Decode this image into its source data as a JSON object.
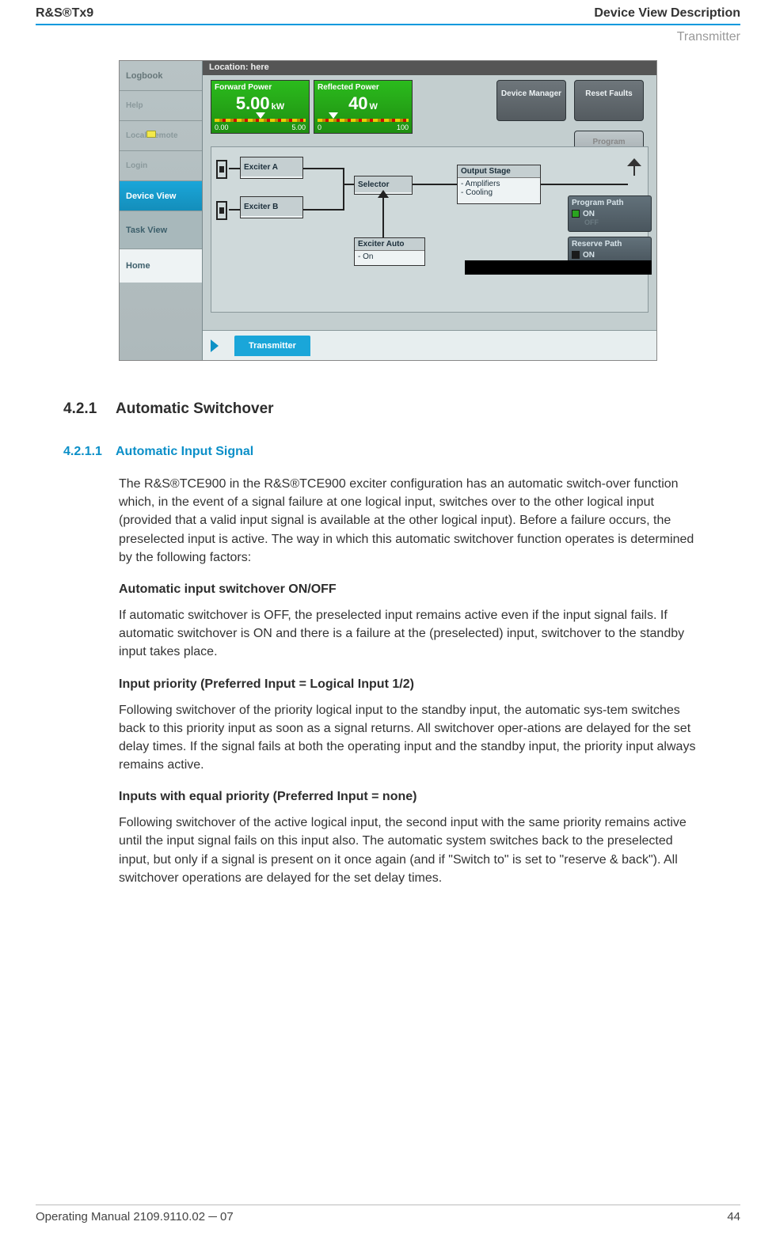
{
  "header": {
    "left": "R&S®Tx9",
    "right": "Device View Description"
  },
  "subheader": "Transmitter",
  "screenshot": {
    "sidebar": {
      "items": [
        {
          "label": "Logbook"
        },
        {
          "label": "Help"
        },
        {
          "label": "Local/Remote"
        },
        {
          "label": "Login"
        },
        {
          "label": "Device View"
        },
        {
          "label": "Task View"
        },
        {
          "label": "Home"
        }
      ]
    },
    "location": "Location: here",
    "forward_power": {
      "label": "Forward Power",
      "value": "5.00",
      "unit": "kW",
      "scale_min": "0.00",
      "scale_max": "5.00"
    },
    "reflected_power": {
      "label": "Reflected Power",
      "value": "40",
      "unit": "W",
      "scale_min": "0",
      "scale_max": "100"
    },
    "buttons": {
      "device_manager": "Device\nManager",
      "reset_faults": "Reset Faults",
      "program": "Program"
    },
    "diagram": {
      "exciter_a": "Exciter A",
      "exciter_b": "Exciter B",
      "selector": "Selector",
      "exciter_auto_title": "Exciter Auto",
      "exciter_auto_state": "- On",
      "output_title": "Output Stage",
      "output_line1": "- Amplifiers",
      "output_line2": "- Cooling"
    },
    "panels": {
      "program_title": "Program Path",
      "program_on": "ON",
      "program_off": "OFF",
      "reserve_title": "Reserve Path",
      "reserve_on": "ON"
    },
    "tab": "Transmitter"
  },
  "sections": {
    "num_4_2_1": "4.2.1",
    "title_4_2_1": "Automatic Switchover",
    "num_4_2_1_1": "4.2.1.1",
    "title_4_2_1_1": "Automatic Input Signal",
    "p1": "The R&S®TCE900 in the R&S®TCE900 exciter configuration has an automatic switch-over function which, in the event of a signal failure at one logical input, switches over to the other logical input (provided that a valid input signal is available at the other logical input). Before a failure occurs, the preselected input is active. The way in which this automatic switchover function operates is determined by the following factors:",
    "h_auto_onoff": "Automatic input switchover ON/OFF",
    "p2": "If automatic switchover is OFF, the preselected input remains active even if the input signal fails. If automatic switchover is ON and there is a failure at the (preselected) input, switchover to the standby input takes place.",
    "h_priority": "Input priority (Preferred Input = Logical Input 1/2)",
    "p3": "Following switchover of the priority logical input to the standby input, the automatic sys-tem switches back to this priority input as soon as a signal returns. All switchover oper-ations are delayed for the set delay times. If the signal fails at both the operating input and the standby input, the priority input always remains active.",
    "h_equal": "Inputs with equal priority (Preferred Input = none)",
    "p4": "Following switchover of the active logical input, the second input with the same priority remains active until the input signal fails on this input also. The automatic system switches back to the preselected input, but only if a signal is present on it once again (and if \"Switch to\" is set to \"reserve & back\"). All switchover operations are delayed for the set delay times."
  },
  "footer": {
    "left": "Operating Manual 2109.9110.02 ─ 07",
    "right": "44"
  }
}
